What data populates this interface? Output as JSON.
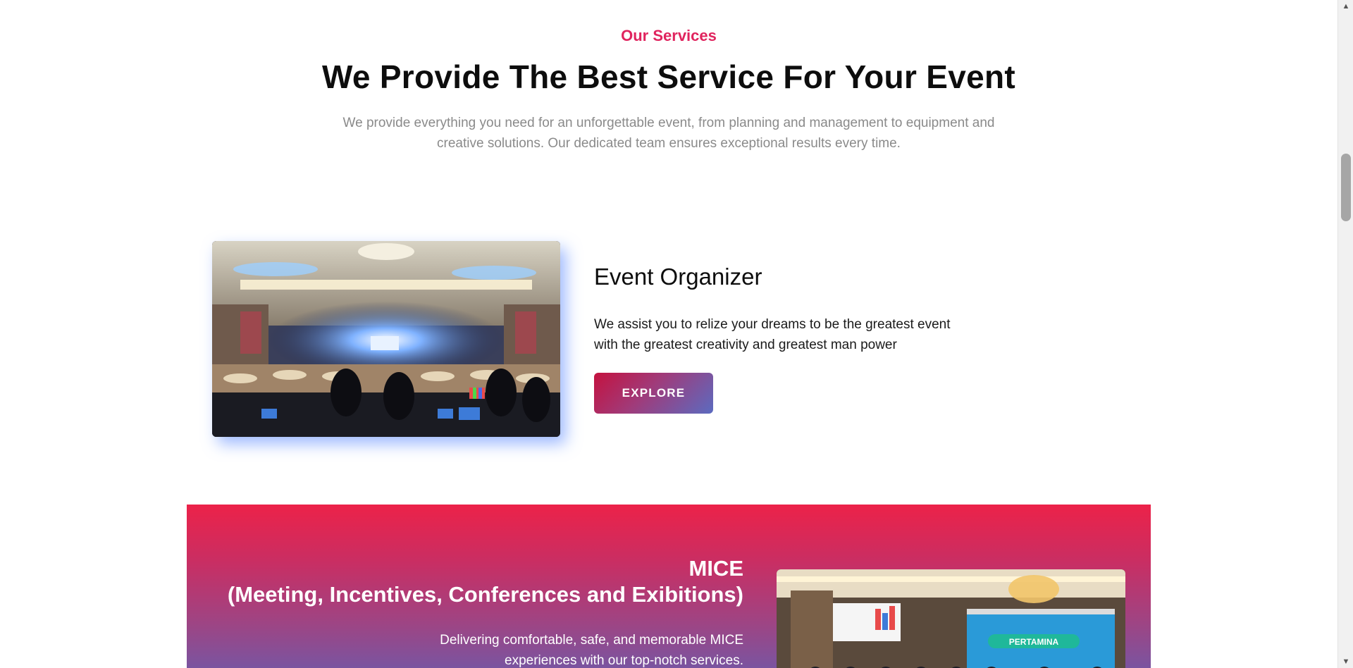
{
  "services": {
    "eyebrow": "Our Services",
    "heading": "We Provide The Best Service For Your Event",
    "intro": "We provide everything you need for an unforgettable event, from planning and management to equipment and creative solutions. Our dedicated team ensures exceptional results every time."
  },
  "event_organizer": {
    "title": "Event Organizer",
    "description": "We assist you to relize your dreams to be the greatest event with the greatest creativity and greatest man power",
    "button_label": "EXPLORE",
    "image_alt": "ballroom-event-stage-photo"
  },
  "mice": {
    "title_line1": "MICE",
    "title_line2": "(Meeting, Incentives, Conferences and Exibitions)",
    "description": "Delivering comfortable, safe, and memorable MICE experiences with our top-notch services.",
    "image_alt": "conference-group-photo",
    "banner_text_line1": "PERTAMINA"
  },
  "colors": {
    "accent": "#e0245e",
    "button_start": "#c4123f",
    "button_end": "#5b6bc0",
    "band_top": "#ec2249",
    "band_bottom": "#7a54a0"
  },
  "icons": {
    "scroll_up": "arrow-up-icon",
    "scroll_down": "arrow-down-icon"
  }
}
